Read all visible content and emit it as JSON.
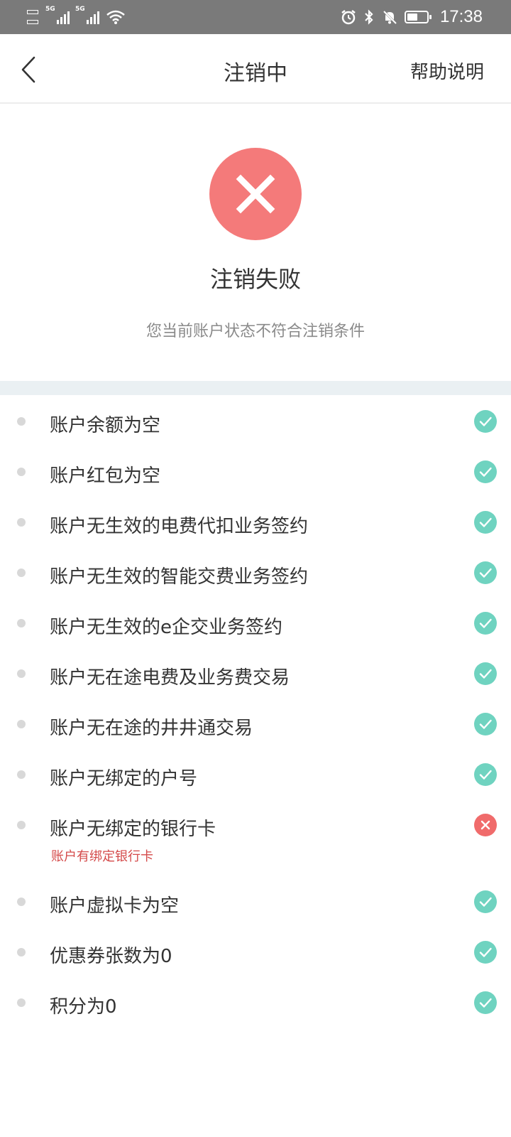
{
  "status_bar": {
    "sig1_tag": "5G",
    "sig2_tag": "5G",
    "time": "17:38",
    "battery_level": 0.55
  },
  "nav": {
    "title": "注销中",
    "help_label": "帮助说明"
  },
  "result": {
    "title": "注销失败",
    "description": "您当前账户状态不符合注销条件"
  },
  "colors": {
    "fail": "#f47a7a",
    "ok": "#6fd3c0",
    "error_text": "#d44a4a",
    "divider": "#eaf0f3"
  },
  "checks": [
    {
      "label": "账户余额为空",
      "passed": true,
      "note": ""
    },
    {
      "label": "账户红包为空",
      "passed": true,
      "note": ""
    },
    {
      "label": "账户无生效的电费代扣业务签约",
      "passed": true,
      "note": ""
    },
    {
      "label": "账户无生效的智能交费业务签约",
      "passed": true,
      "note": ""
    },
    {
      "label": "账户无生效的e企交业务签约",
      "passed": true,
      "note": ""
    },
    {
      "label": "账户无在途电费及业务费交易",
      "passed": true,
      "note": ""
    },
    {
      "label": "账户无在途的井井通交易",
      "passed": true,
      "note": ""
    },
    {
      "label": "账户无绑定的户号",
      "passed": true,
      "note": ""
    },
    {
      "label": "账户无绑定的银行卡",
      "passed": false,
      "note": "账户有绑定银行卡"
    },
    {
      "label": "账户虚拟卡为空",
      "passed": true,
      "note": ""
    },
    {
      "label": "优惠券张数为0",
      "passed": true,
      "note": ""
    },
    {
      "label": "积分为0",
      "passed": true,
      "note": ""
    }
  ]
}
